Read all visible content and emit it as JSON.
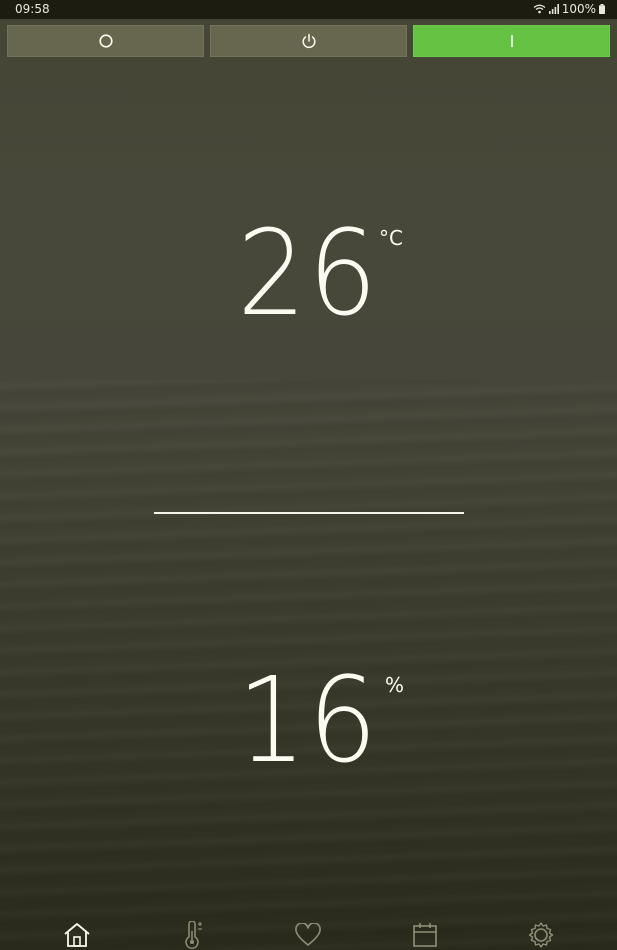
{
  "status_bar": {
    "time": "09:58",
    "battery": "100%"
  },
  "mode_buttons": [
    {
      "name": "off",
      "icon": "circle-icon",
      "active": false
    },
    {
      "name": "power",
      "icon": "power-icon",
      "active": false
    },
    {
      "name": "on",
      "icon": "on-line-icon",
      "active": true
    }
  ],
  "temperature": {
    "value": "26",
    "unit": "°C"
  },
  "humidity": {
    "value": "16",
    "unit": "%"
  },
  "nav": [
    {
      "name": "home",
      "icon": "home-icon",
      "active": true
    },
    {
      "name": "thermostat",
      "icon": "thermometer-icon",
      "active": false
    },
    {
      "name": "favorites",
      "icon": "heart-icon",
      "active": false
    },
    {
      "name": "schedule",
      "icon": "calendar-icon",
      "active": false
    },
    {
      "name": "settings",
      "icon": "gear-icon",
      "active": false
    }
  ],
  "colors": {
    "active_mode": "#65c242",
    "inactive_mode": "#67674f",
    "text": "#fbfbf2"
  }
}
